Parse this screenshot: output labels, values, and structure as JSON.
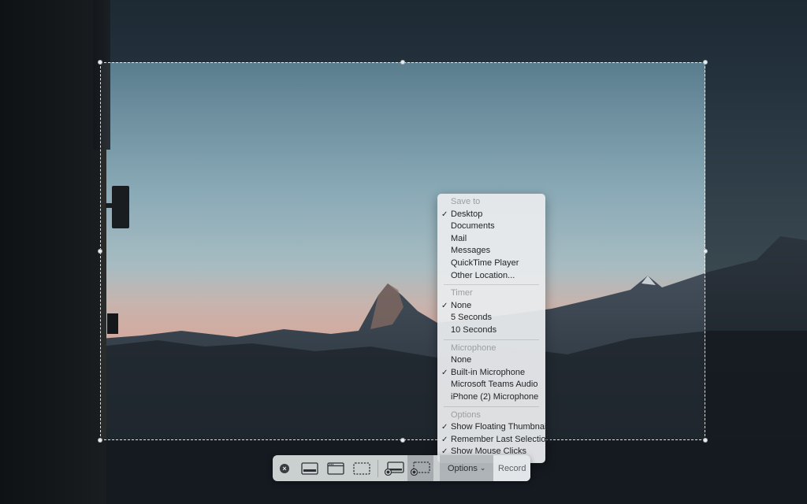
{
  "toolbar": {
    "close_icon": "close-circle-icon",
    "modes": [
      {
        "name": "capture-entire-screen",
        "icon": "entire-screen-icon",
        "active": false
      },
      {
        "name": "capture-selected-window",
        "icon": "window-icon",
        "active": false
      },
      {
        "name": "capture-selected-portion",
        "icon": "selection-icon",
        "active": false
      },
      {
        "name": "record-entire-screen",
        "icon": "record-screen-icon",
        "active": false
      },
      {
        "name": "record-selected-portion",
        "icon": "record-selection-icon",
        "active": true
      }
    ],
    "options_label": "Options",
    "options_chevron": "⌄",
    "record_label": "Record"
  },
  "menu": {
    "save_to": {
      "header": "Save to",
      "items": [
        {
          "label": "Desktop",
          "checked": true
        },
        {
          "label": "Documents",
          "checked": false
        },
        {
          "label": "Mail",
          "checked": false
        },
        {
          "label": "Messages",
          "checked": false
        },
        {
          "label": "QuickTime Player",
          "checked": false
        },
        {
          "label": "Other Location...",
          "checked": false
        }
      ]
    },
    "timer": {
      "header": "Timer",
      "items": [
        {
          "label": "None",
          "checked": true
        },
        {
          "label": "5 Seconds",
          "checked": false
        },
        {
          "label": "10 Seconds",
          "checked": false
        }
      ]
    },
    "microphone": {
      "header": "Microphone",
      "items": [
        {
          "label": "None",
          "checked": false
        },
        {
          "label": "Built-in Microphone",
          "checked": true
        },
        {
          "label": "Microsoft Teams Audio",
          "checked": false
        },
        {
          "label": "iPhone (2) Microphone",
          "checked": false
        }
      ]
    },
    "options": {
      "header": "Options",
      "items": [
        {
          "label": "Show Floating Thumbnail",
          "checked": true
        },
        {
          "label": "Remember Last Selection",
          "checked": true
        },
        {
          "label": "Show Mouse Clicks",
          "checked": true
        }
      ]
    },
    "check_glyph": "✓"
  },
  "colors": {
    "menu_bg": "#e9ebed",
    "header_text": "#9a9fa3",
    "toolbar_bg": "#dadee0"
  }
}
